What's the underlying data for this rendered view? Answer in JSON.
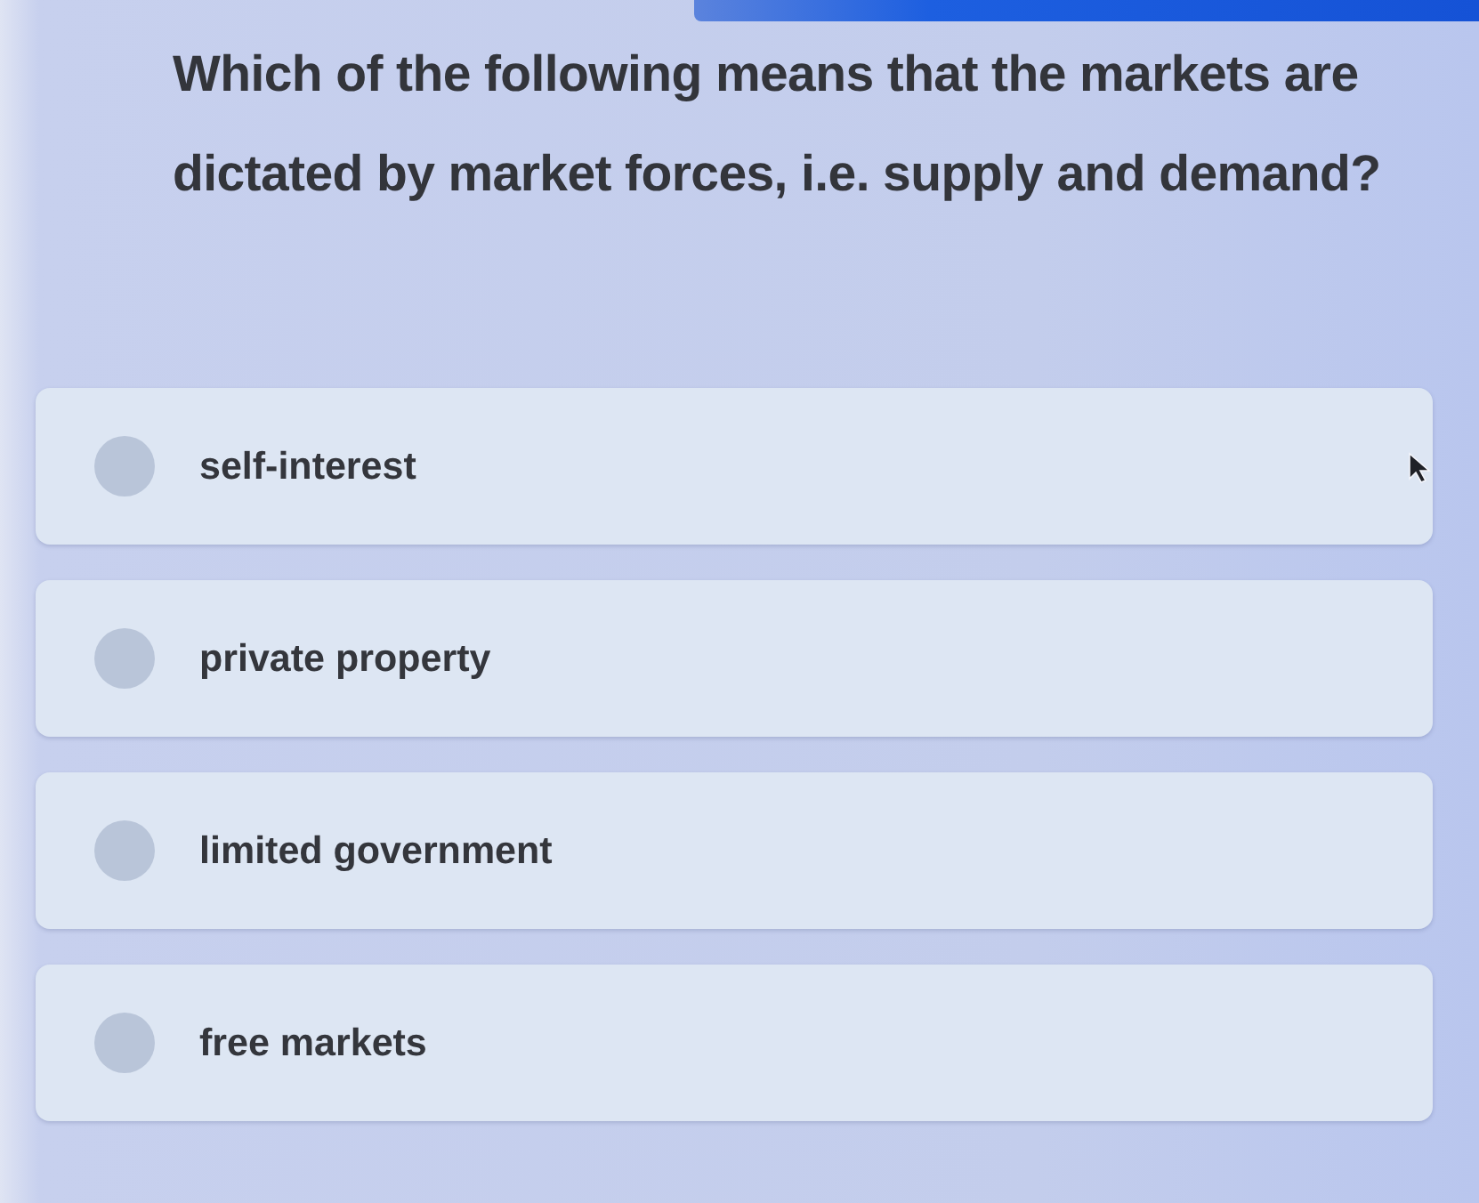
{
  "question": "Which of the following means that the markets are dictated by market forces, i.e. supply and demand?",
  "options": [
    {
      "label": "self-interest",
      "selected": false
    },
    {
      "label": "private property",
      "selected": false
    },
    {
      "label": "limited government",
      "selected": false
    },
    {
      "label": "free markets",
      "selected": false
    }
  ]
}
